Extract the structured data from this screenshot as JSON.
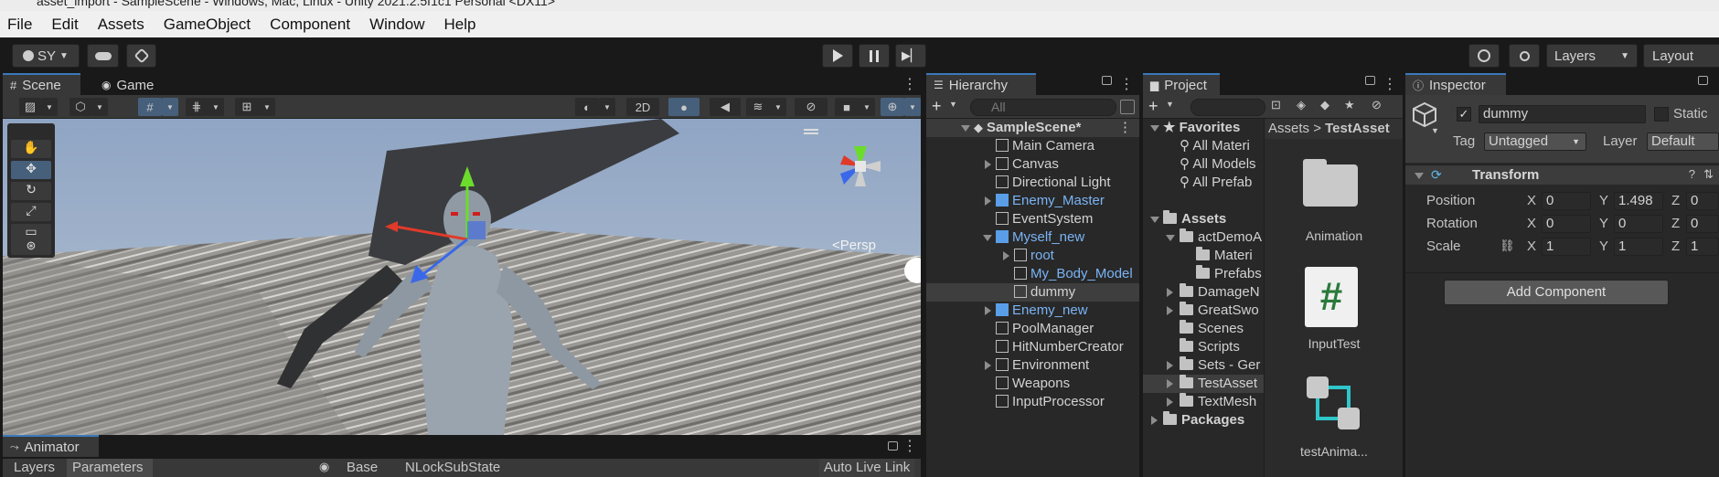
{
  "window": {
    "title": "asset_import - SampleScene - Windows, Mac, Linux - Unity 2021.2.5f1c1 Personal <DX11>"
  },
  "menu": [
    "File",
    "Edit",
    "Assets",
    "GameObject",
    "Component",
    "Window",
    "Help"
  ],
  "toolbar": {
    "account": "SY",
    "layers": "Layers",
    "layout": "Layout"
  },
  "scene": {
    "tab_scene": "Scene",
    "tab_game": "Game",
    "btn_2d": "2D",
    "persp": "<Persp"
  },
  "hierarchy": {
    "tab": "Hierarchy",
    "search_placeholder": "All",
    "scene_name": "SampleScene*",
    "items": [
      {
        "label": "Main Camera"
      },
      {
        "label": "Canvas"
      },
      {
        "label": "Directional Light"
      },
      {
        "label": "Enemy_Master"
      },
      {
        "label": "EventSystem"
      },
      {
        "label": "Myself_new"
      },
      {
        "label": "root"
      },
      {
        "label": "My_Body_Model"
      },
      {
        "label": "dummy"
      },
      {
        "label": "Enemy_new"
      },
      {
        "label": "PoolManager"
      },
      {
        "label": "HitNumberCreator"
      },
      {
        "label": "Environment"
      },
      {
        "label": "Weapons"
      },
      {
        "label": "InputProcessor"
      }
    ]
  },
  "project": {
    "tab": "Project",
    "breadcrumb": [
      "Assets",
      ">",
      "TestAsset"
    ],
    "favorites": "Favorites",
    "fav_items": [
      "All Materi",
      "All Models",
      "All Prefab"
    ],
    "assets": "Assets",
    "tree": [
      "actDemoA",
      "Materi",
      "Prefabs",
      "DamageN",
      "GreatSwo",
      "Scenes",
      "Scripts",
      "Sets - Ger",
      "TestAsset",
      "TextMesh"
    ],
    "packages": "Packages",
    "grid": [
      {
        "label": "Animation"
      },
      {
        "label": "InputTest",
        "glyph": "#"
      },
      {
        "label": "testAnima..."
      }
    ]
  },
  "inspector": {
    "tab": "Inspector",
    "object_name": "dummy",
    "static_label": "Static",
    "tag_label": "Tag",
    "tag_value": "Untagged",
    "layer_label": "Layer",
    "layer_value": "Default",
    "transform": "Transform",
    "position": {
      "label": "Position",
      "x": "0",
      "y": "1.498",
      "z": "0"
    },
    "rotation": {
      "label": "Rotation",
      "x": "0",
      "y": "0",
      "z": "0"
    },
    "scale": {
      "label": "Scale",
      "x": "1",
      "y": "1",
      "z": "1"
    },
    "axis": {
      "x": "X",
      "y": "Y",
      "z": "Z"
    },
    "add_component": "Add Component"
  },
  "animator": {
    "tab": "Animator",
    "layers": "Layers",
    "parameters": "Parameters",
    "base": "Base",
    "substate": "NLockSubState",
    "auto_live": "Auto Live Link"
  },
  "colors": {
    "accent": "#3a79bb",
    "prefab_blue": "#7ab4f5",
    "panel": "#282828",
    "header": "#383838"
  }
}
